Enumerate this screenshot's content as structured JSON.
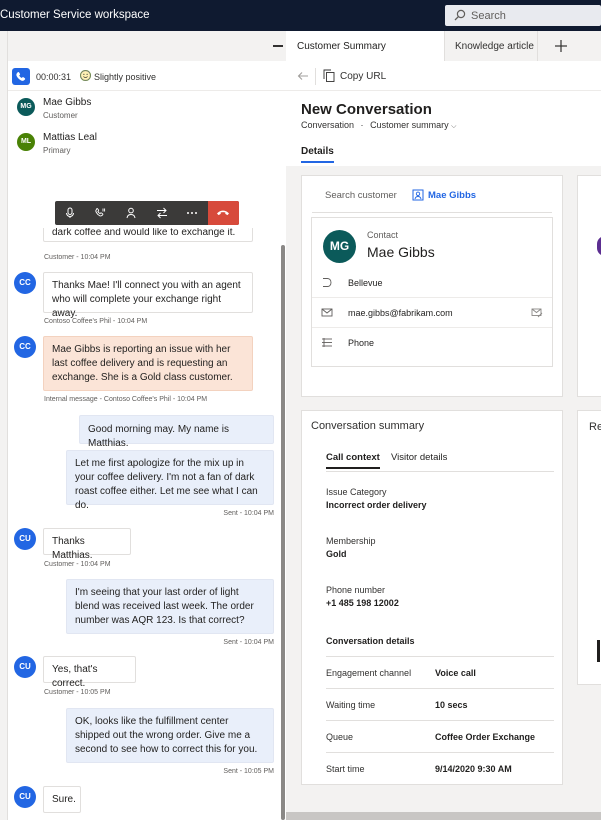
{
  "app": {
    "title": "Customer Service workspace",
    "search_placeholder": "Search"
  },
  "call": {
    "timer": "00:00:31",
    "sentiment": "Slightly positive"
  },
  "participants": [
    {
      "initials": "MG",
      "name": "Mae Gibbs",
      "role": "Customer",
      "color": "#0b5a5a"
    },
    {
      "initials": "ML",
      "name": "Mattias Leal",
      "role": "Primary",
      "color": "#498205"
    }
  ],
  "chat": [
    {
      "type": "customer",
      "text": "dark coffee and would like to exchange it.",
      "meta": "Customer - 10:04 PM"
    },
    {
      "type": "internal",
      "avatar": "CC",
      "text": "Thanks Mae! I'll connect you with an agent who will complete your exchange right away.",
      "meta": "Contoso Coffee's Phil - 10:04 PM"
    },
    {
      "type": "internal-note",
      "avatar": "CC",
      "text": "Mae Gibbs is reporting an issue with her last coffee delivery and is requesting an exchange. She is a Gold class customer.",
      "meta": "Internal message - Contoso Coffee's Phil - 10:04 PM"
    },
    {
      "type": "agent",
      "text": "Good morning may. My name is Matthias.",
      "meta": ""
    },
    {
      "type": "agent",
      "text": "Let me first apologize for the mix up in your coffee delivery. I'm not a fan of dark roast coffee either. Let me see what I can do.",
      "meta": "Sent - 10:04 PM"
    },
    {
      "type": "customer",
      "avatar": "CU",
      "text": "Thanks Matthias.",
      "meta": "Customer - 10:04 PM"
    },
    {
      "type": "agent",
      "text": "I'm seeing that your last order of light blend was received last week. The order number was AQR 123. Is that correct?",
      "meta": "Sent - 10:04 PM"
    },
    {
      "type": "customer",
      "avatar": "CU",
      "text": "Yes, that's correct.",
      "meta": "Customer - 10:05 PM"
    },
    {
      "type": "agent",
      "text": "OK, looks like the fulfillment center shipped out the wrong order. Give me a second to see how to correct this for you.",
      "meta": "Sent - 10:05 PM"
    },
    {
      "type": "customer",
      "avatar": "CU",
      "text": "Sure.",
      "meta": ""
    }
  ],
  "tabs": [
    {
      "label": "Customer Summary",
      "active": true
    },
    {
      "label": "Knowledge article ...",
      "active": false
    }
  ],
  "commands": {
    "copy_url": "Copy URL"
  },
  "form": {
    "title": "New Conversation",
    "entity": "Conversation",
    "separator": "·",
    "view": "Customer summary",
    "section_tab": "Details"
  },
  "customer_card": {
    "search_label": "Search customer",
    "selected_customer": "Mae Gibbs",
    "contact_label": "Contact",
    "initials": "MG",
    "name": "Mae Gibbs",
    "city": "Bellevue",
    "email": "mae.gibbs@fabrikam.com",
    "phone_label": "Phone"
  },
  "conversation_summary": {
    "title": "Conversation summary",
    "tabs": [
      "Call context",
      "Visitor details"
    ],
    "fields": [
      {
        "label": "Issue Category",
        "value": "Incorrect order delivery"
      },
      {
        "label": "Membership",
        "value": "Gold"
      },
      {
        "label": "Phone number",
        "value": "+1 485 198 12002"
      }
    ],
    "details_heading": "Conversation details",
    "details": [
      {
        "label": "Engagement channel",
        "value": "Voice call"
      },
      {
        "label": "Waiting time",
        "value": "10 secs"
      },
      {
        "label": "Queue",
        "value": "Coffee Order Exchange"
      },
      {
        "label": "Start time",
        "value": "9/14/2020 9:30 AM"
      }
    ]
  },
  "peek": {
    "right_card_label": "Re"
  },
  "colors": {
    "topbar": "#0f1a30",
    "accent": "#2266e3",
    "end_call": "#d74a3b",
    "internal_note": "#fbe4d7",
    "agent_bubble": "#e9effa"
  },
  "icons": [
    "search-icon",
    "phone-icon",
    "smile-icon",
    "mic-icon",
    "hold-icon",
    "consult-icon",
    "transfer-icon",
    "more-icon",
    "end-call-icon",
    "back-arrow-icon",
    "copy-icon",
    "contact-card-icon",
    "location-icon",
    "mail-icon",
    "phone-line-icon",
    "add-tab-icon"
  ]
}
